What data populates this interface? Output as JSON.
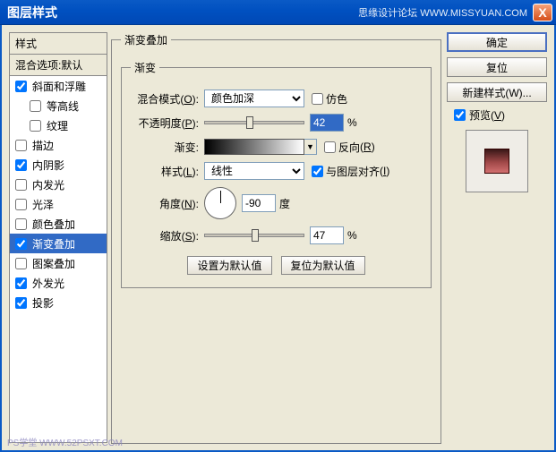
{
  "window": {
    "title": "图层样式",
    "watermark": "思缘设计论坛  WWW.MISSYUAN.COM",
    "close": "X"
  },
  "styles_panel": {
    "header": "样式",
    "sub": "混合选项:默认",
    "items": [
      {
        "label": "斜面和浮雕",
        "checked": true,
        "indent": false
      },
      {
        "label": "等高线",
        "checked": false,
        "indent": true
      },
      {
        "label": "纹理",
        "checked": false,
        "indent": true
      },
      {
        "label": "描边",
        "checked": false,
        "indent": false
      },
      {
        "label": "内阴影",
        "checked": true,
        "indent": false
      },
      {
        "label": "内发光",
        "checked": false,
        "indent": false
      },
      {
        "label": "光泽",
        "checked": false,
        "indent": false
      },
      {
        "label": "颜色叠加",
        "checked": false,
        "indent": false
      },
      {
        "label": "渐变叠加",
        "checked": true,
        "indent": false,
        "selected": true
      },
      {
        "label": "图案叠加",
        "checked": false,
        "indent": false
      },
      {
        "label": "外发光",
        "checked": true,
        "indent": false
      },
      {
        "label": "投影",
        "checked": true,
        "indent": false
      }
    ]
  },
  "settings": {
    "outer_legend": "渐变叠加",
    "inner_legend": "渐变",
    "labels": {
      "blend_mode": "混合模式",
      "blend_mode_key": "O",
      "opacity": "不透明度",
      "opacity_key": "P",
      "gradient": "渐变",
      "style": "样式",
      "style_key": "L",
      "angle": "角度",
      "angle_key": "N",
      "scale": "缩放",
      "scale_key": "S"
    },
    "blend_mode_value": "颜色加深",
    "dither_label": "仿色",
    "dither_checked": false,
    "opacity_value": "42",
    "opacity_unit": "%",
    "reverse_label": "反向",
    "reverse_key": "R",
    "reverse_checked": false,
    "align_label": "与图层对齐",
    "align_key": "I",
    "align_checked": true,
    "style_value": "线性",
    "angle_value": "-90",
    "angle_unit": "度",
    "scale_value": "47",
    "scale_unit": "%",
    "set_default_btn": "设置为默认值",
    "reset_default_btn": "复位为默认值"
  },
  "right": {
    "ok": "确定",
    "reset": "复位",
    "new_style": "新建样式(W)...",
    "preview_label": "预览",
    "preview_key": "V",
    "preview_checked": true
  },
  "footer_wm": "PS学堂  WWW.52PSXT.COM"
}
